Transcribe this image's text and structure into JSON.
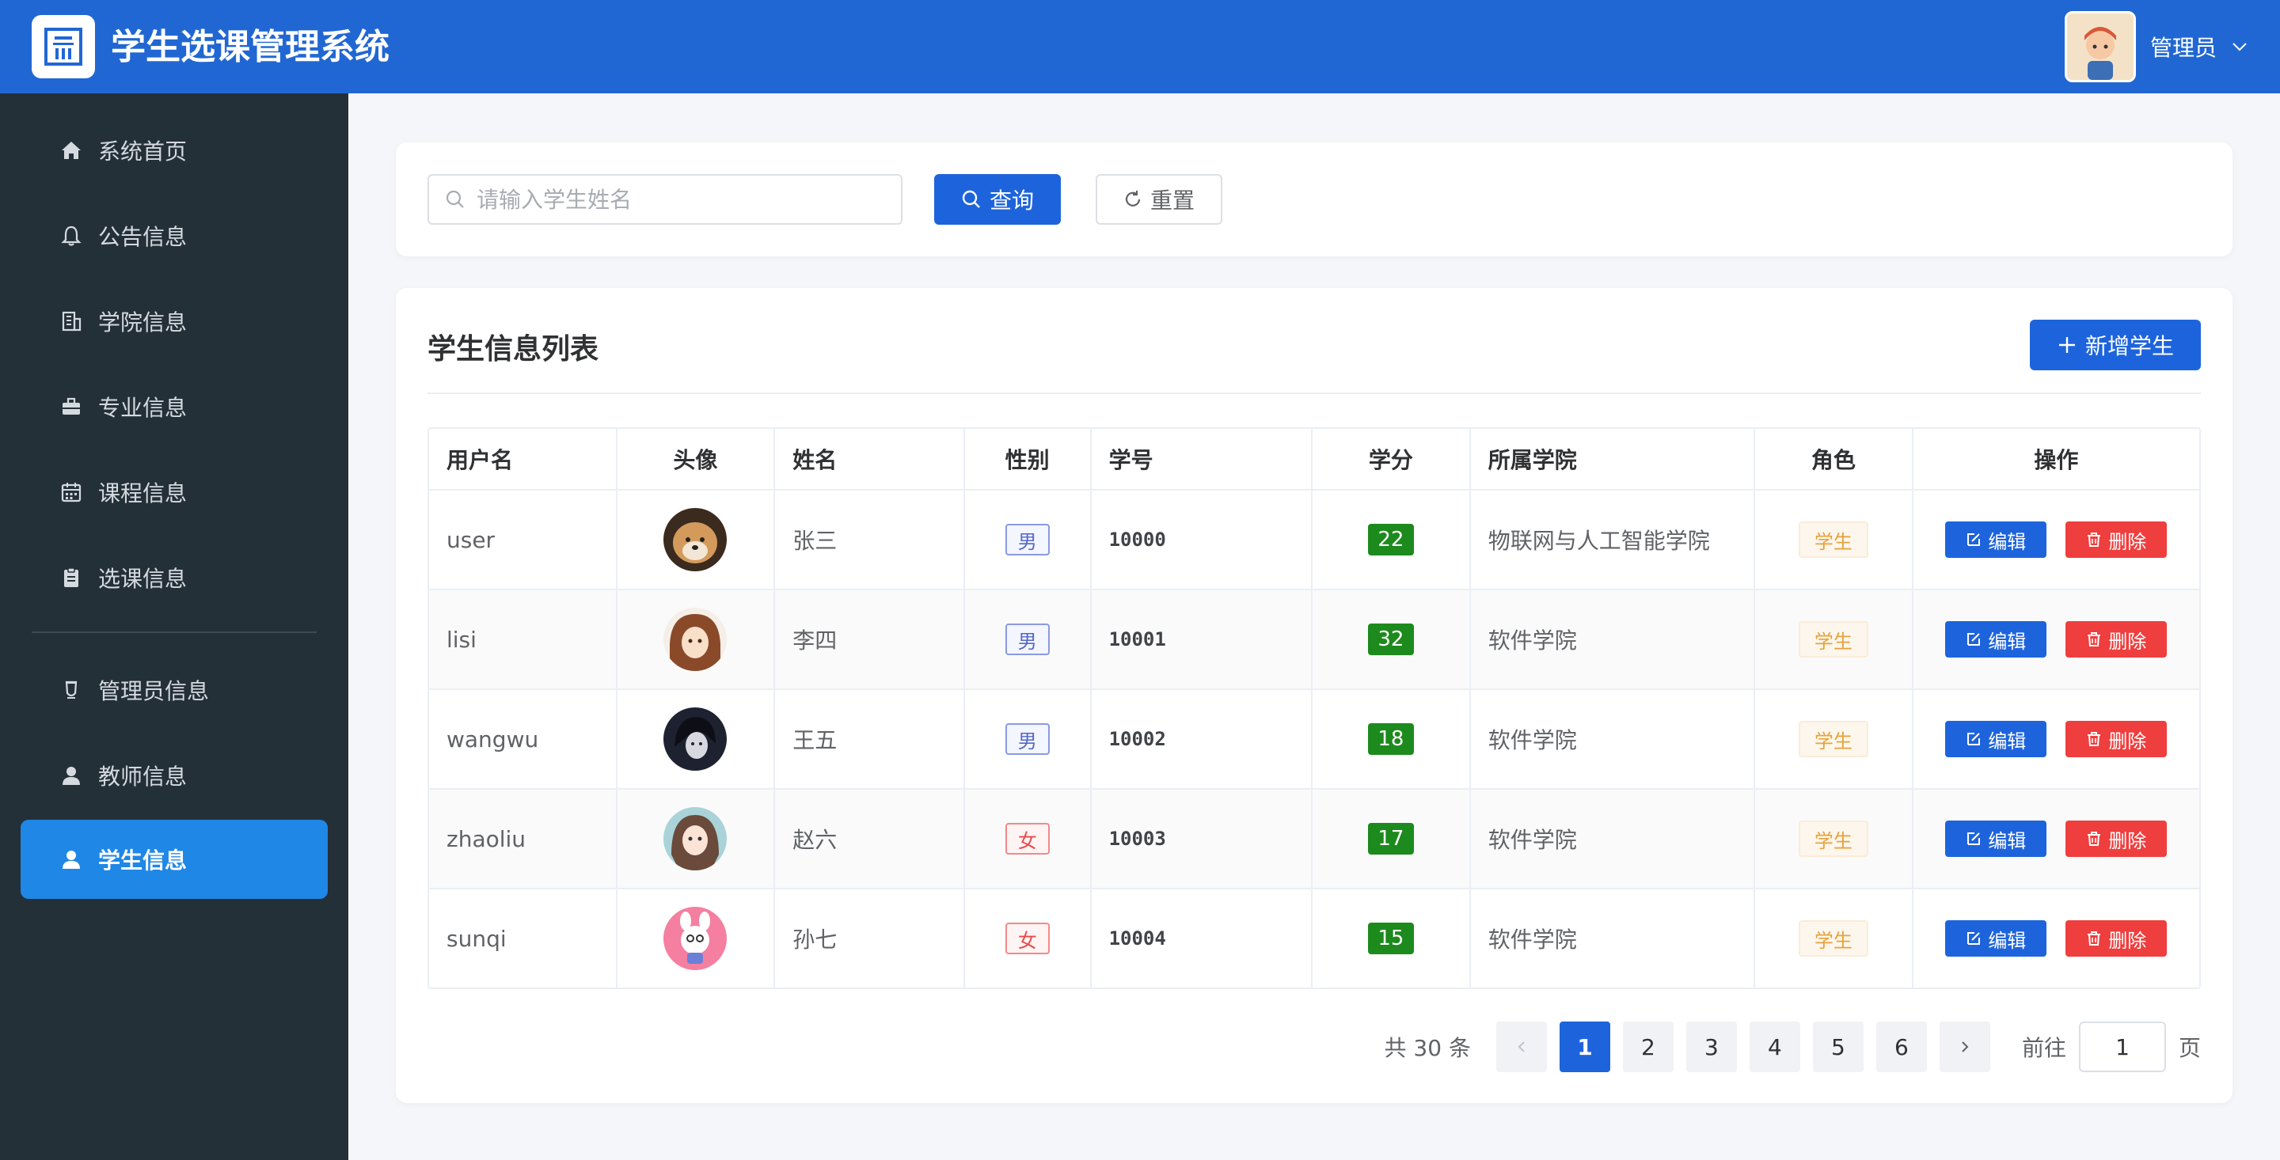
{
  "header": {
    "title": "学生选课管理系统",
    "user_name": "管理员"
  },
  "sidebar": {
    "items": [
      {
        "label": "系统首页",
        "icon": "home-icon"
      },
      {
        "label": "公告信息",
        "icon": "bell-icon"
      },
      {
        "label": "学院信息",
        "icon": "building-icon"
      },
      {
        "label": "专业信息",
        "icon": "briefcase-icon"
      },
      {
        "label": "课程信息",
        "icon": "calendar-icon"
      },
      {
        "label": "选课信息",
        "icon": "clipboard-icon"
      },
      {
        "label": "管理员信息",
        "icon": "cup-icon"
      },
      {
        "label": "教师信息",
        "icon": "user-icon"
      },
      {
        "label": "学生信息",
        "icon": "user-icon",
        "active": true
      }
    ]
  },
  "search": {
    "placeholder": "请输入学生姓名",
    "value": "",
    "query_label": "查询",
    "reset_label": "重置"
  },
  "list": {
    "title": "学生信息列表",
    "add_label": "新增学生",
    "columns": [
      "用户名",
      "头像",
      "姓名",
      "性别",
      "学号",
      "学分",
      "所属学院",
      "角色",
      "操作"
    ],
    "rows": [
      {
        "username": "user",
        "name": "张三",
        "gender": "男",
        "sno": "10000",
        "credit": "22",
        "college": "物联网与人工智能学院",
        "role": "学生"
      },
      {
        "username": "lisi",
        "name": "李四",
        "gender": "男",
        "sno": "10001",
        "credit": "32",
        "college": "软件学院",
        "role": "学生"
      },
      {
        "username": "wangwu",
        "name": "王五",
        "gender": "男",
        "sno": "10002",
        "credit": "18",
        "college": "软件学院",
        "role": "学生"
      },
      {
        "username": "zhaoliu",
        "name": "赵六",
        "gender": "女",
        "sno": "10003",
        "credit": "17",
        "college": "软件学院",
        "role": "学生"
      },
      {
        "username": "sunqi",
        "name": "孙七",
        "gender": "女",
        "sno": "10004",
        "credit": "15",
        "college": "软件学院",
        "role": "学生"
      }
    ],
    "edit_label": "编辑",
    "delete_label": "删除"
  },
  "pagination": {
    "total_text": "共 30 条",
    "pages": [
      "1",
      "2",
      "3",
      "4",
      "5",
      "6"
    ],
    "current": "1",
    "goto_prefix": "前往",
    "goto_value": "1",
    "goto_suffix": "页"
  },
  "colors": {
    "header": "#2167d3",
    "sidebar": "#243038",
    "active": "#1f87e5",
    "primary": "#1d64dc",
    "danger": "#ef3e3e",
    "credit": "#1c8a1c"
  }
}
